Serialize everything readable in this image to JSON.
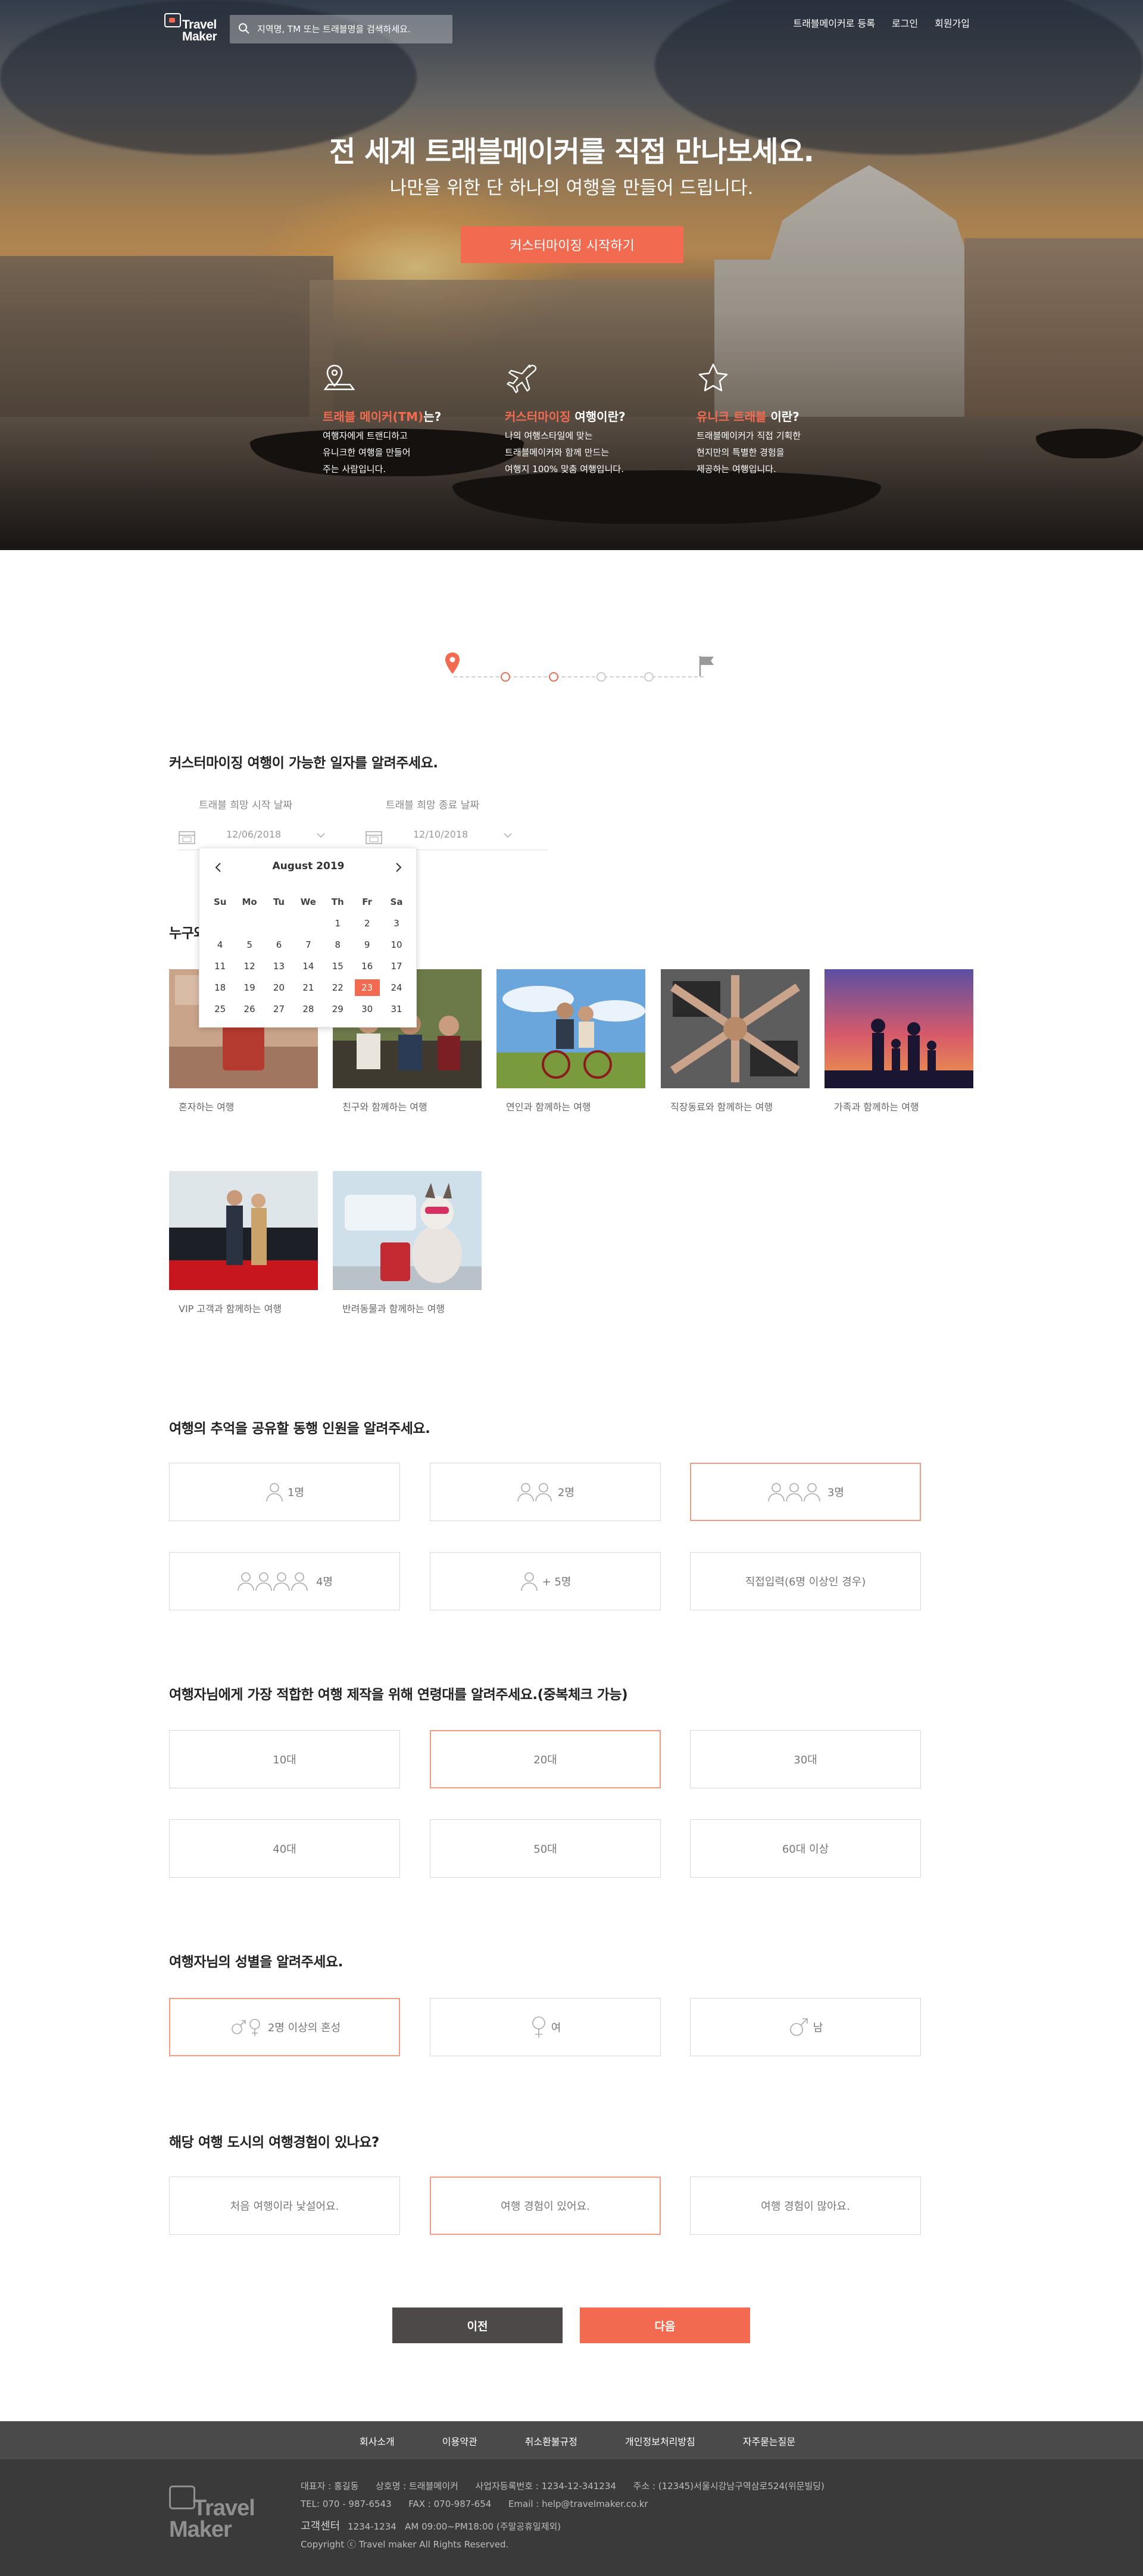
{
  "header": {
    "logo_line1": "Travel",
    "logo_line2": "Maker",
    "search_placeholder": "지역명, TM 또는 트래블명을 검색하세요.",
    "nav": [
      "트래블메이커로 등록",
      "로그인",
      "회원가입"
    ]
  },
  "hero": {
    "title": "전 세계 트래블메이커를 직접 만나보세요.",
    "subtitle": "나만을 위한 단 하나의 여행을 만들어 드립니다.",
    "cta_label": "커스터마이징 시작하기",
    "features": [
      {
        "icon": "map-pin-icon",
        "title_highlight": "트래블 메이커(TM)",
        "title_rest": "는?",
        "desc": "여행자에게 트랜디하고\n유니크한 여행을 만들어\n주는 사람입니다."
      },
      {
        "icon": "airplane-icon",
        "title_highlight": "커스터마이징",
        "title_rest": " 여행이란?",
        "desc": "나의 여행스타일에 맞는\n트래블메이커와 함께 만드는\n여행지 100% 맞춤 여행입니다."
      },
      {
        "icon": "star-icon",
        "title_highlight": "유니크 트래블",
        "title_rest": " 이란?",
        "desc": "트래블메이커가 직접 기획한\n현지만의 특별한 경험을\n제공하는 여행입니다."
      }
    ]
  },
  "stepper": {
    "total": 6,
    "current": 1,
    "completed": 2
  },
  "dates": {
    "question": "커스터마이징 여행이 가능한 일자를 알려주세요.",
    "start_label": "트래블 희망 시작 날짜",
    "end_label": "트래블 희망 종료 날짜",
    "start_value": "12/06/2018",
    "end_value": "12/10/2018",
    "calendar": {
      "month_label": "August 2019",
      "weekdays": [
        "Su",
        "Mo",
        "Tu",
        "We",
        "Th",
        "Fr",
        "Sa"
      ],
      "weeks": [
        [
          "",
          "",
          "",
          "",
          "1",
          "2",
          "3"
        ],
        [
          "4",
          "5",
          "6",
          "7",
          "8",
          "9",
          "10"
        ],
        [
          "11",
          "12",
          "13",
          "14",
          "15",
          "16",
          "17"
        ],
        [
          "18",
          "19",
          "20",
          "21",
          "22",
          "23",
          "24"
        ],
        [
          "25",
          "26",
          "27",
          "28",
          "29",
          "30",
          "31"
        ]
      ],
      "selected": "23"
    }
  },
  "companions": {
    "question_partial": "누구와",
    "tiles": [
      {
        "label": "혼자하는 여행"
      },
      {
        "label": "친구와 함께하는 여행"
      },
      {
        "label": "연인과 함께하는 여행"
      },
      {
        "label": "직장동료와 함께하는 여행"
      },
      {
        "label": "가족과 함께하는 여행"
      },
      {
        "label": "VIP 고객과 함께하는 여행"
      },
      {
        "label": "반려동물과 함께하는 여행"
      }
    ]
  },
  "party_size": {
    "question": "여행의 추억을 공유할 동행 인원을 알려주세요.",
    "options": [
      "1명",
      "2명",
      "3명",
      "4명",
      "+ 5명",
      "직접입력(6명 이상인 경우)"
    ],
    "selected_index": 2
  },
  "ages": {
    "question": "여행자님에게 가장 적합한 여행 제작을 위해 연령대를 알려주세요.(중복체크 가능)",
    "options": [
      "10대",
      "20대",
      "30대",
      "40대",
      "50대",
      "60대 이상"
    ],
    "selected_index": 1
  },
  "gender": {
    "question": "여행자님의 성별을 알려주세요.",
    "options": [
      "2명 이상의 혼성",
      "여",
      "남"
    ],
    "selected_index": 0
  },
  "experience": {
    "question": "해당 여행 도시의 여행경험이 있나요?",
    "options": [
      "처음 여행이라 낯설어요.",
      "여행 경험이 있어요.",
      "여행 경험이 많아요."
    ],
    "selected_index": 1
  },
  "actions": {
    "prev_label": "이전",
    "next_label": "다음"
  },
  "footer": {
    "links": [
      "회사소개",
      "이용약관",
      "취소환불규정",
      "개인정보처리방침",
      "자주묻는질문"
    ],
    "logo_line1": "Travel",
    "logo_line2": "Maker",
    "info_line1": "대표자 : 홍길동      상호명 : 트래블메이커      사업자등록번호 : 1234-12-341234      주소 : (12345)서울시강남구역삼로524(위문빌딩)",
    "info_line2": "TEL: 070 - 987-6543      FAX : 070-987-654      Email : help@travelmaker.co.kr",
    "cs_label": "고객센터",
    "cs_hours": "1234-1234   AM 09:00~PM18:00 (주말공휴일제외)",
    "copyright": "Copyright ⓒ Travel maker All Rights Reserved."
  },
  "colors": {
    "accent": "#f26b50",
    "selected_border": "#f49a85",
    "dark_button": "#4d4948",
    "footer_nav": "#4a4a4a",
    "footer_body": "#3a3a3a"
  }
}
